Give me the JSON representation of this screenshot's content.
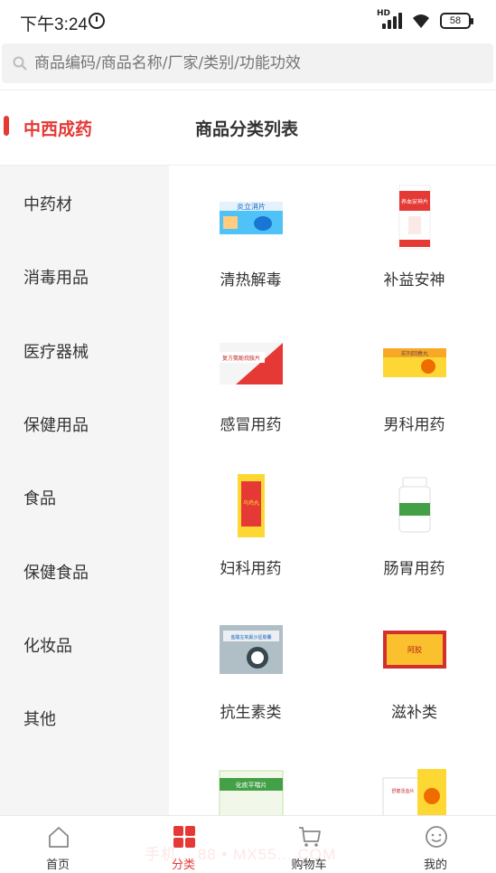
{
  "status_bar": {
    "time": "下午3:24",
    "network": "HD",
    "battery": "58"
  },
  "search": {
    "placeholder": "商品编码/商品名称/厂家/类别/功能功效"
  },
  "header": {
    "active_category": "中西成药",
    "list_title": "商品分类列表"
  },
  "sidebar": {
    "items": [
      {
        "label": "中药材"
      },
      {
        "label": "消毒用品"
      },
      {
        "label": "医疗器械"
      },
      {
        "label": "保健用品"
      },
      {
        "label": "食品"
      },
      {
        "label": "保健食品"
      },
      {
        "label": "化妆品"
      },
      {
        "label": "其他"
      }
    ]
  },
  "categories": [
    {
      "label": "清热解毒",
      "box_text": "炎立消片"
    },
    {
      "label": "补益安神",
      "box_text": "养血安神片"
    },
    {
      "label": "感冒用药",
      "box_text": "复方氨酚烷胺片"
    },
    {
      "label": "男科用药",
      "box_text": "前列回春丸"
    },
    {
      "label": "妇科用药",
      "box_text": "乌鸡丸"
    },
    {
      "label": "肠胃用药",
      "box_text": ""
    },
    {
      "label": "抗生素类",
      "box_text": "盐酸左氧氟沙星胶囊"
    },
    {
      "label": "滋补类",
      "box_text": "阿胶"
    },
    {
      "label": "",
      "box_text": "化痰平喘片"
    },
    {
      "label": "",
      "box_text": "舒筋活血片"
    }
  ],
  "tabbar": {
    "items": [
      {
        "label": "首页"
      },
      {
        "label": "分类"
      },
      {
        "label": "购物车"
      },
      {
        "label": "我的"
      }
    ]
  },
  "watermark": "手机... 88 • MX55... COM",
  "colors": {
    "accent": "#e53935",
    "sidebar_bg": "#f5f5f5"
  }
}
